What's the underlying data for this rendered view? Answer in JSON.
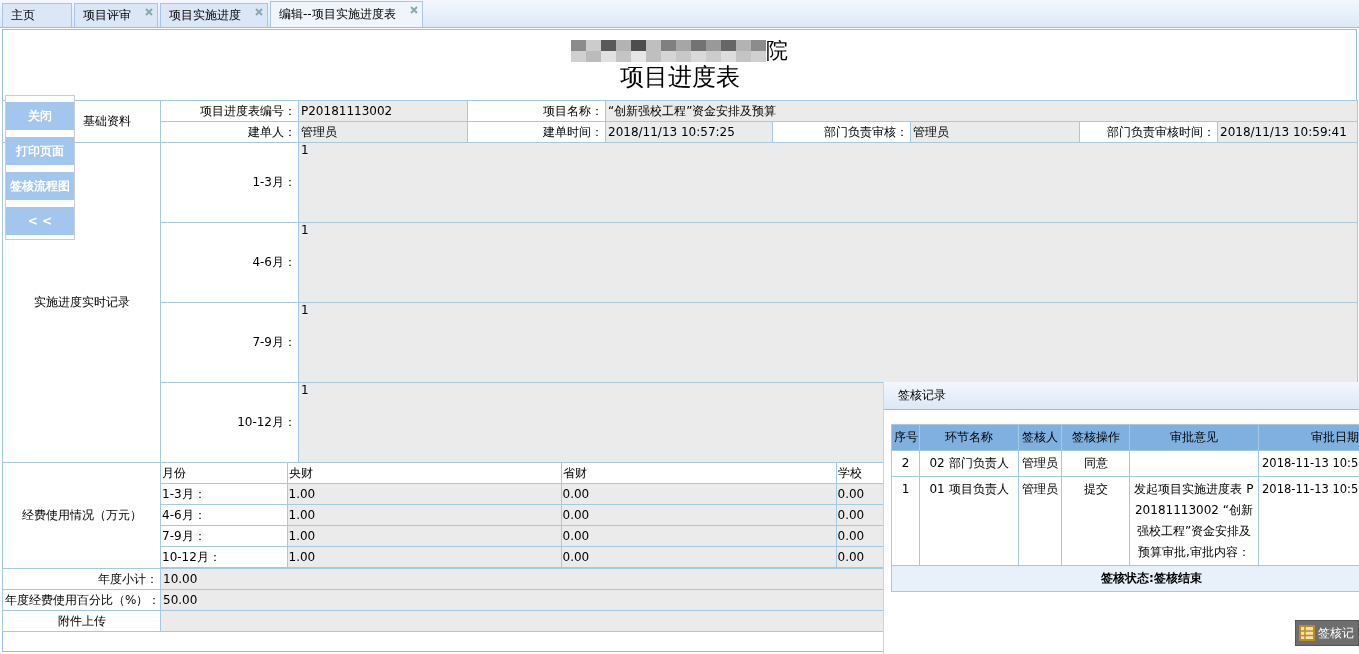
{
  "tabs": [
    {
      "label": "主页",
      "closable": false,
      "selected": false
    },
    {
      "label": "项目评审",
      "closable": true,
      "selected": false
    },
    {
      "label": "项目实施进度",
      "closable": true,
      "selected": false
    },
    {
      "label": "编辑--项目实施进度表",
      "closable": true,
      "selected": true
    }
  ],
  "header": {
    "org_suffix": "院",
    "title": "项目进度表"
  },
  "side_buttons": [
    "关闭",
    "打印页面",
    "签核流程图",
    "< <"
  ],
  "basic": {
    "section": "基础资料",
    "rows": [
      [
        {
          "label": "项目进度表编号：",
          "value": "P20181113002"
        },
        {
          "label": "项目名称：",
          "value": "“创新强校工程”资金安排及预算"
        }
      ],
      [
        {
          "label": "建单人：",
          "value": "管理员"
        },
        {
          "label": "建单时间：",
          "value": "2018/11/13 10:57:25"
        },
        {
          "label": "部门负责审核：",
          "value": "管理员"
        },
        {
          "label": "部门负责审核时间：",
          "value": "2018/11/13 10:59:41"
        }
      ]
    ]
  },
  "progress": {
    "section": "实施进度实时记录",
    "rows": [
      {
        "period": "1-3月：",
        "value": "1"
      },
      {
        "period": "4-6月：",
        "value": "1"
      },
      {
        "period": "7-9月：",
        "value": "1"
      },
      {
        "period": "10-12月：",
        "value": "1"
      }
    ]
  },
  "funds": {
    "section": "经费使用情况（万元）",
    "columns": [
      "月份",
      "央财",
      "省财",
      "学校"
    ],
    "rows": [
      [
        "1-3月：",
        "1.00",
        "0.00",
        "0.00"
      ],
      [
        "4-6月：",
        "1.00",
        "0.00",
        "0.00"
      ],
      [
        "7-9月：",
        "1.00",
        "0.00",
        "0.00"
      ],
      [
        "10-12月：",
        "1.00",
        "0.00",
        "0.00"
      ]
    ]
  },
  "summary": [
    {
      "kind": "field",
      "label": "年度小计：",
      "value": "10.00"
    },
    {
      "kind": "field",
      "label": "年度经费使用百分比（%）：",
      "value": "50.00"
    },
    {
      "kind": "upload",
      "label": "附件上传"
    }
  ],
  "sign_panel": {
    "title": "签核记录",
    "columns": [
      "序号",
      "环节名称",
      "签核人",
      "签核操作",
      "审批意见",
      "审批日期"
    ],
    "rows": [
      {
        "no": "2",
        "step": "02 部门负责人",
        "signer": "管理员",
        "action": "同意",
        "date": "2018-11-13 10:5"
      },
      {
        "no": "1",
        "step": "01 项目负责人",
        "signer": "管理员",
        "action": "提交",
        "opinion": "发起项目实施进度表 P20181113002 “创新强校工程”资金安排及预算审批,审批内容：",
        "date": "2018-11-13 10:5"
      }
    ],
    "status": "签核状态:签核结束"
  },
  "float_button": {
    "label": "签核记"
  }
}
